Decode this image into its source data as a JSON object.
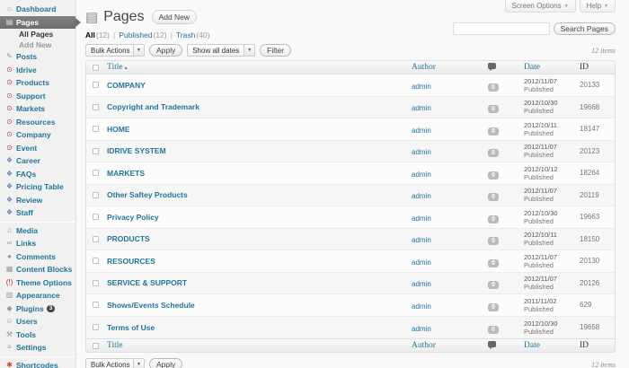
{
  "screen_tabs": {
    "screen_options": "Screen Options",
    "help": "Help"
  },
  "header": {
    "title": "Pages",
    "add_new": "Add New"
  },
  "search": {
    "button": "Search Pages",
    "value": ""
  },
  "views": {
    "all": {
      "label": "All",
      "count": "(12)"
    },
    "published": {
      "label": "Published",
      "count": "(12)"
    },
    "trash": {
      "label": "Trash",
      "count": "(40)"
    }
  },
  "toolbar": {
    "bulk_actions": "Bulk Actions",
    "apply": "Apply",
    "dates_filter": "Show all dates",
    "filter": "Filter",
    "items_count": "12 items"
  },
  "footer": {
    "bulk_actions": "Bulk Actions",
    "apply": "Apply",
    "items_count": "12 items"
  },
  "icons": {
    "sort_asc": "▴",
    "dropdown_arrow": "▼",
    "page": "▤"
  },
  "colors": {
    "link_blue": "#21759b",
    "current_menu_bg": "#6d6d6d",
    "accent_red": "#c9413a"
  },
  "table": {
    "columns": {
      "title": "Title",
      "author": "Author",
      "date": "Date",
      "id": "ID"
    },
    "rows": [
      {
        "title": "COMPANY",
        "author": "admin",
        "comments": "0",
        "date": "2012/11/07",
        "status": "Published",
        "id": "20133"
      },
      {
        "title": "Copyright and Trademark",
        "author": "admin",
        "comments": "0",
        "date": "2012/10/30",
        "status": "Published",
        "id": "19668"
      },
      {
        "title": "HOME",
        "author": "admin",
        "comments": "0",
        "date": "2012/10/11",
        "status": "Published",
        "id": "18147"
      },
      {
        "title": "IDRIVE SYSTEM",
        "author": "admin",
        "comments": "0",
        "date": "2012/11/07",
        "status": "Published",
        "id": "20123"
      },
      {
        "title": "MARKETS",
        "author": "admin",
        "comments": "0",
        "date": "2012/10/12",
        "status": "Published",
        "id": "18264"
      },
      {
        "title": "Other Saftey Products",
        "author": "admin",
        "comments": "0",
        "date": "2012/11/07",
        "status": "Published",
        "id": "20119"
      },
      {
        "title": "Privacy Policy",
        "author": "admin",
        "comments": "0",
        "date": "2012/10/30",
        "status": "Published",
        "id": "19663"
      },
      {
        "title": "PRODUCTS",
        "author": "admin",
        "comments": "0",
        "date": "2012/10/11",
        "status": "Published",
        "id": "18150"
      },
      {
        "title": "RESOURCES",
        "author": "admin",
        "comments": "0",
        "date": "2012/11/07",
        "status": "Published",
        "id": "20130"
      },
      {
        "title": "SERVICE & SUPPORT",
        "author": "admin",
        "comments": "0",
        "date": "2012/11/07",
        "status": "Published",
        "id": "20126"
      },
      {
        "title": "Shows/Events Schedule",
        "author": "admin",
        "comments": "0",
        "date": "2011/11/02",
        "status": "Published",
        "id": "629"
      },
      {
        "title": "Terms of Use",
        "author": "admin",
        "comments": "0",
        "date": "2012/10/30",
        "status": "Published",
        "id": "19658"
      }
    ]
  },
  "sidebar": {
    "items": [
      {
        "label": "Dashboard",
        "icon": "dashboard-icon",
        "glyph": "⌂",
        "type": "item"
      },
      {
        "label": "Pages",
        "icon": "pages-icon",
        "glyph": "▤",
        "type": "current"
      },
      {
        "label": "All Pages",
        "type": "sub-current"
      },
      {
        "label": "Add New",
        "type": "sub"
      },
      {
        "label": "Posts",
        "icon": "posts-icon",
        "glyph": "✎",
        "type": "item"
      },
      {
        "label": "Idrive",
        "icon": "custom-post-type-icon",
        "glyph": "⊙",
        "icon_color": "#c9413a",
        "type": "item"
      },
      {
        "label": "Products",
        "icon": "custom-post-type-icon",
        "glyph": "⊙",
        "icon_color": "#c9413a",
        "type": "item"
      },
      {
        "label": "Support",
        "icon": "custom-post-type-icon",
        "glyph": "⊙",
        "icon_color": "#c9413a",
        "type": "item"
      },
      {
        "label": "Markets",
        "icon": "custom-post-type-icon",
        "glyph": "⊙",
        "icon_color": "#c9413a",
        "type": "item"
      },
      {
        "label": "Resources",
        "icon": "custom-post-type-icon",
        "glyph": "⊙",
        "icon_color": "#c9413a",
        "type": "item"
      },
      {
        "label": "Company",
        "icon": "custom-post-type-icon",
        "glyph": "⊙",
        "icon_color": "#c9413a",
        "type": "item"
      },
      {
        "label": "Event",
        "icon": "custom-post-type-icon",
        "glyph": "⊙",
        "icon_color": "#c9413a",
        "type": "item"
      },
      {
        "label": "Career",
        "icon": "layers-icon",
        "glyph": "❖",
        "icon_color": "#5a7fb5",
        "type": "item"
      },
      {
        "label": "FAQs",
        "icon": "layers-icon",
        "glyph": "❖",
        "icon_color": "#5a7fb5",
        "type": "item"
      },
      {
        "label": "Pricing Table",
        "icon": "layers-icon",
        "glyph": "❖",
        "icon_color": "#5a7fb5",
        "type": "item"
      },
      {
        "label": "Review",
        "icon": "layers-icon",
        "glyph": "❖",
        "icon_color": "#5a7fb5",
        "type": "item"
      },
      {
        "label": "Staff",
        "icon": "layers-icon",
        "glyph": "❖",
        "icon_color": "#5a7fb5",
        "type": "item"
      },
      {
        "type": "separator"
      },
      {
        "label": "Media",
        "icon": "media-icon",
        "glyph": "♫",
        "type": "item"
      },
      {
        "label": "Links",
        "icon": "links-icon",
        "glyph": "∞",
        "type": "item"
      },
      {
        "label": "Comments",
        "icon": "comments-icon",
        "glyph": "●",
        "type": "item"
      },
      {
        "label": "Content Blocks",
        "icon": "content-blocks-icon",
        "glyph": "▦",
        "type": "item"
      },
      {
        "label": "Theme Options",
        "icon": "theme-options-alert-icon",
        "glyph": "(!)",
        "icon_color": "#cc2222",
        "type": "item"
      },
      {
        "label": "Appearance",
        "icon": "appearance-icon",
        "glyph": "▨",
        "type": "item"
      },
      {
        "label": "Plugins",
        "icon": "plugins-icon",
        "glyph": "◆",
        "type": "item",
        "badge": "3"
      },
      {
        "label": "Users",
        "icon": "users-icon",
        "glyph": "☺",
        "type": "item"
      },
      {
        "label": "Tools",
        "icon": "tools-icon",
        "glyph": "⚒",
        "type": "item"
      },
      {
        "label": "Settings",
        "icon": "settings-icon",
        "glyph": "≡",
        "type": "item"
      },
      {
        "type": "separator"
      },
      {
        "label": "Shortcodes",
        "icon": "shortcodes-icon",
        "glyph": "✱",
        "icon_color": "#cc4422",
        "type": "item"
      }
    ]
  }
}
